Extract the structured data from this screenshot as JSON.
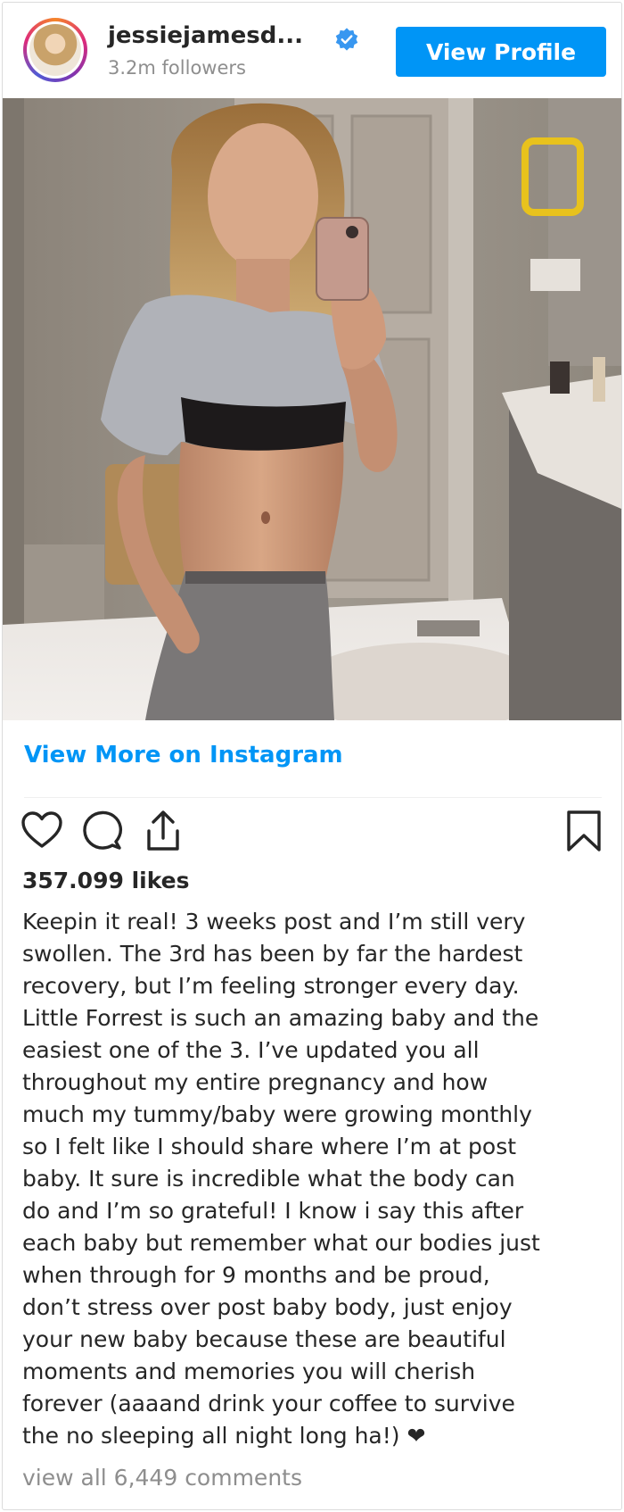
{
  "header": {
    "username": "jessiejamesd...",
    "followers": "3.2m followers",
    "view_profile_label": "View Profile",
    "verified_badge_color": "#3897f0"
  },
  "post": {
    "photo_icon": "mirror-selfie-photo",
    "view_more_label": "View More on Instagram",
    "actions": [
      "heart-icon",
      "comment-icon",
      "share-icon",
      "bookmark-icon"
    ],
    "likes": "357.099 likes",
    "caption": "Keepin it real! 3 weeks post and I’m still very\nswollen. The 3rd has been by far the hardest\nrecovery, but I’m feeling stronger every day.\nLittle Forrest is such an amazing baby and the\neasiest one of the 3. I’ve updated you all\nthroughout my entire pregnancy and how\nmuch my tummy/baby were growing monthly\nso I felt like I should share where I’m at post\nbaby. It sure is incredible what the body can\ndo and I’m so grateful! I know i say this after\neach baby but remember what our bodies just\nwhen through for 9 months and be proud,\ndon’t stress over post baby body, just enjoy\nyour new baby because these are beautiful\nmoments and memories you will cherish\nforever (aaaand drink your coffee to survive\nthe no sleeping all night long ha!) ❤",
    "comments_link": "view all 6,449 comments"
  },
  "colors": {
    "accent": "#0095f6",
    "text": "#262626",
    "muted": "#8e8e8e"
  }
}
